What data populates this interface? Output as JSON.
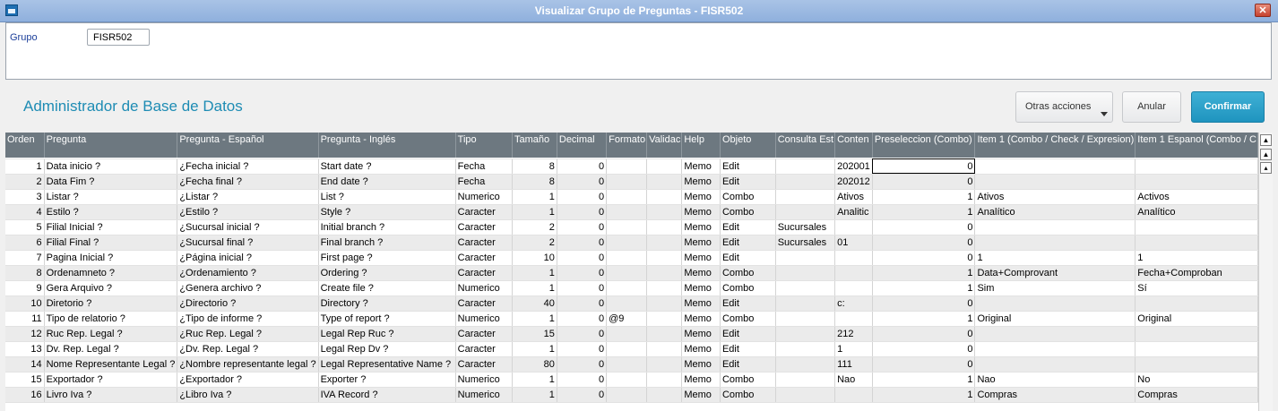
{
  "window": {
    "title": "Visualizar Grupo de Preguntas - FISR502"
  },
  "form": {
    "grupo_label": "Grupo",
    "grupo_value": "FISR502"
  },
  "header": {
    "title": "Administrador de Base de Datos"
  },
  "actions": {
    "otras": "Otras acciones",
    "anular": "Anular",
    "confirmar": "Confirmar"
  },
  "colors": {
    "accent": "#1f94bf",
    "grid_header": "#6d7880",
    "title_bar": "#9ab7e1"
  },
  "columns": [
    "Orden",
    "Pregunta",
    "Pregunta - Español",
    "Pregunta - Inglés",
    "Tipo",
    "Tamaño",
    "Decimal",
    "Formato",
    "Validac",
    "Help",
    "Objeto",
    "Consulta Est",
    "Conten",
    "Preseleccion (Combo)",
    "Item 1 (Combo / Check / Expresion)",
    "Item 1 Espanol (Combo / C"
  ],
  "rows": [
    [
      "1",
      "Data inicio ?",
      "¿Fecha inicial ?",
      "Start date ?",
      "Fecha",
      "8",
      "0",
      "",
      "",
      "Memo",
      "Edit",
      "",
      "202001",
      "0",
      "",
      ""
    ],
    [
      "2",
      "Data Fim ?",
      "¿Fecha final ?",
      "End date ?",
      "Fecha",
      "8",
      "0",
      "",
      "",
      "Memo",
      "Edit",
      "",
      "202012",
      "0",
      "",
      ""
    ],
    [
      "3",
      "Listar ?",
      "¿Listar ?",
      "List ?",
      "Numerico",
      "1",
      "0",
      "",
      "",
      "Memo",
      "Combo",
      "",
      "Ativos",
      "1",
      "Ativos",
      "Activos"
    ],
    [
      "4",
      "Estilo ?",
      "¿Estilo ?",
      "Style ?",
      "Caracter",
      "1",
      "0",
      "",
      "",
      "Memo",
      "Combo",
      "",
      "Analitic",
      "1",
      "Analítico",
      "Analítico"
    ],
    [
      "5",
      "Filial Inicial ?",
      "¿Sucursal inicial ?",
      "Initial branch ?",
      "Caracter",
      "2",
      "0",
      "",
      "",
      "Memo",
      "Edit",
      "Sucursales",
      "",
      "0",
      "",
      ""
    ],
    [
      "6",
      "Filial Final ?",
      "¿Sucursal final ?",
      "Final branch ?",
      "Caracter",
      "2",
      "0",
      "",
      "",
      "Memo",
      "Edit",
      "Sucursales",
      "01",
      "0",
      "",
      ""
    ],
    [
      "7",
      "Pagina Inicial ?",
      "¿Página inicial ?",
      "First page ?",
      "Caracter",
      "10",
      "0",
      "",
      "",
      "Memo",
      "Edit",
      "",
      "",
      "0",
      "1",
      "1"
    ],
    [
      "8",
      "Ordenamneto ?",
      "¿Ordenamiento ?",
      "Ordering ?",
      "Caracter",
      "1",
      "0",
      "",
      "",
      "Memo",
      "Combo",
      "",
      "",
      "1",
      "Data+Comprovant",
      "Fecha+Comproban"
    ],
    [
      "9",
      "Gera Arquivo ?",
      "¿Genera archivo ?",
      "Create file ?",
      "Numerico",
      "1",
      "0",
      "",
      "",
      "Memo",
      "Combo",
      "",
      "",
      "1",
      "Sim",
      "Sí"
    ],
    [
      "10",
      "Diretorio ?",
      "¿Directorio ?",
      "Directory ?",
      "Caracter",
      "40",
      "0",
      "",
      "",
      "Memo",
      "Edit",
      "",
      "c:",
      "0",
      "",
      ""
    ],
    [
      "11",
      "Tipo de relatorio ?",
      "¿Tipo de informe ?",
      "Type of report ?",
      "Numerico",
      "1",
      "0",
      "@9",
      "",
      "Memo",
      "Combo",
      "",
      "",
      "1",
      "Original",
      "Original"
    ],
    [
      "12",
      "Ruc Rep. Legal ?",
      "¿Ruc Rep. Legal ?",
      "Legal Rep Ruc ?",
      "Caracter",
      "15",
      "0",
      "",
      "",
      "Memo",
      "Edit",
      "",
      "212",
      "0",
      "",
      ""
    ],
    [
      "13",
      "Dv. Rep. Legal ?",
      "¿Dv. Rep. Legal ?",
      "Legal Rep Dv ?",
      "Caracter",
      "1",
      "0",
      "",
      "",
      "Memo",
      "Edit",
      "",
      "1",
      "0",
      "",
      ""
    ],
    [
      "14",
      "Nome Representante Legal ?",
      "¿Nombre representante legal ?",
      "Legal Representative Name ?",
      "Caracter",
      "80",
      "0",
      "",
      "",
      "Memo",
      "Edit",
      "",
      "111",
      "0",
      "",
      ""
    ],
    [
      "15",
      "Exportador ?",
      "¿Exportador ?",
      "Exporter ?",
      "Numerico",
      "1",
      "0",
      "",
      "",
      "Memo",
      "Combo",
      "",
      "Nao",
      "1",
      "Nao",
      "No"
    ],
    [
      "16",
      "Livro Iva ?",
      "¿Libro Iva ?",
      "IVA Record ?",
      "Numerico",
      "1",
      "0",
      "",
      "",
      "Memo",
      "Combo",
      "",
      "",
      "1",
      "Compras",
      "Compras"
    ]
  ]
}
